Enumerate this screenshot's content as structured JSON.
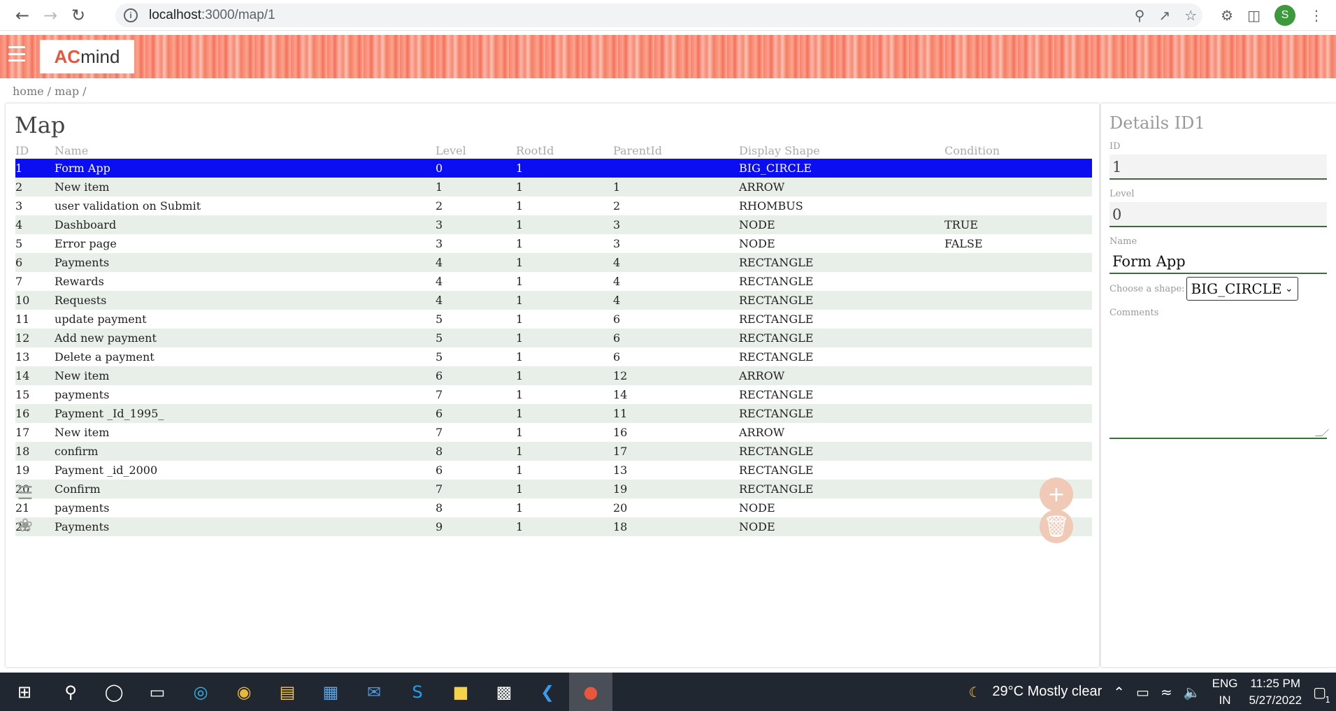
{
  "browser": {
    "url_host": "localhost",
    "url_rest": ":3000/map/1",
    "avatar_letter": "S"
  },
  "header": {
    "logo_prefix": "AC",
    "logo_suffix": "mind"
  },
  "breadcrumb": "home / map /",
  "main": {
    "title": "Map",
    "columns": [
      "ID",
      "Name",
      "Level",
      "RootId",
      "ParentId",
      "Display Shape",
      "Condition"
    ],
    "rows": [
      [
        "1",
        "Form App",
        "0",
        "1",
        "",
        "BIG_CIRCLE",
        ""
      ],
      [
        "2",
        "New item",
        "1",
        "1",
        "1",
        "ARROW",
        ""
      ],
      [
        "3",
        "user validation on Submit",
        "2",
        "1",
        "2",
        "RHOMBUS",
        ""
      ],
      [
        "4",
        "Dashboard",
        "3",
        "1",
        "3",
        "NODE",
        "TRUE"
      ],
      [
        "5",
        "Error page",
        "3",
        "1",
        "3",
        "NODE",
        "FALSE"
      ],
      [
        "6",
        "Payments",
        "4",
        "1",
        "4",
        "RECTANGLE",
        ""
      ],
      [
        "7",
        "Rewards",
        "4",
        "1",
        "4",
        "RECTANGLE",
        ""
      ],
      [
        "10",
        "Requests",
        "4",
        "1",
        "4",
        "RECTANGLE",
        ""
      ],
      [
        "11",
        "update payment",
        "5",
        "1",
        "6",
        "RECTANGLE",
        ""
      ],
      [
        "12",
        "Add new payment",
        "5",
        "1",
        "6",
        "RECTANGLE",
        ""
      ],
      [
        "13",
        "Delete a payment",
        "5",
        "1",
        "6",
        "RECTANGLE",
        ""
      ],
      [
        "14",
        "New item",
        "6",
        "1",
        "12",
        "ARROW",
        ""
      ],
      [
        "15",
        "payments",
        "7",
        "1",
        "14",
        "RECTANGLE",
        ""
      ],
      [
        "16",
        "Payment _Id_1995_",
        "6",
        "1",
        "11",
        "RECTANGLE",
        ""
      ],
      [
        "17",
        "New item",
        "7",
        "1",
        "16",
        "ARROW",
        ""
      ],
      [
        "18",
        "confirm",
        "8",
        "1",
        "17",
        "RECTANGLE",
        ""
      ],
      [
        "19",
        "Payment _id_2000",
        "6",
        "1",
        "13",
        "RECTANGLE",
        ""
      ],
      [
        "20",
        "Confirm",
        "7",
        "1",
        "19",
        "RECTANGLE",
        ""
      ],
      [
        "21",
        "payments",
        "8",
        "1",
        "20",
        "NODE",
        ""
      ],
      [
        "22",
        "Payments",
        "9",
        "1",
        "18",
        "NODE",
        ""
      ]
    ],
    "selected_row": 0
  },
  "details": {
    "title": "Details ID1",
    "id_label": "ID",
    "id_value": "1",
    "level_label": "Level",
    "level_value": "0",
    "name_label": "Name",
    "name_value": "Form App",
    "shape_label": "Choose a shape:",
    "shape_value": "BIG_CIRCLE",
    "comments_label": "Comments"
  },
  "taskbar": {
    "weather": "29°C  Mostly clear",
    "lang_top": "ENG",
    "lang_bottom": "IN",
    "time": "11:25 PM",
    "date": "5/27/2022",
    "notifications": "1"
  },
  "colors": {
    "selected_row": "#0a0ef0",
    "accent": "#f47e64",
    "field_underline": "#3a6e3a"
  }
}
